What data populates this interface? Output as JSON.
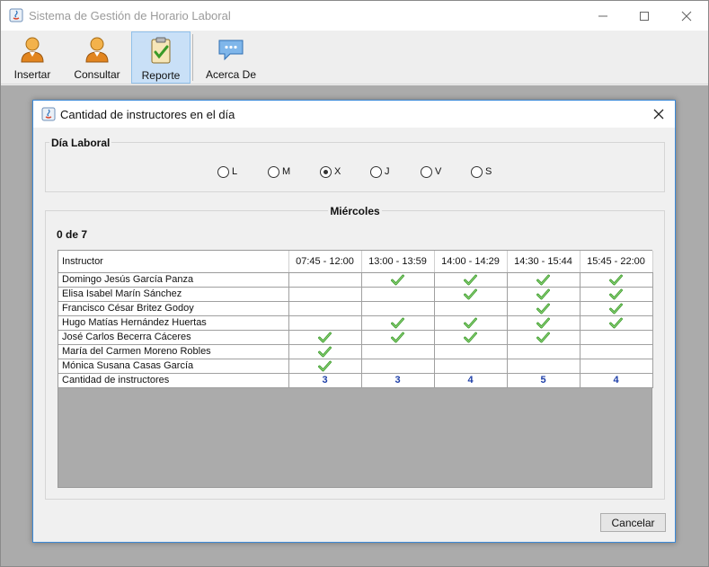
{
  "window": {
    "title": "Sistema de Gestión de Horario Laboral",
    "controls": [
      "minimize-icon",
      "maximize-icon",
      "close-icon"
    ]
  },
  "toolbar": {
    "buttons": [
      {
        "label": "Insertar",
        "icon": "user-icon"
      },
      {
        "label": "Consultar",
        "icon": "user-icon"
      },
      {
        "label": "Reporte",
        "icon": "clipboard-check-icon",
        "active": true
      },
      {
        "label": "Acerca De",
        "icon": "speech-bubble-icon"
      }
    ]
  },
  "dialog": {
    "title": "Cantidad de instructores en el día",
    "day_group": {
      "legend": "Día Laboral",
      "options": [
        "L",
        "M",
        "X",
        "J",
        "V",
        "S"
      ],
      "selected": "X"
    },
    "report_group": {
      "legend": "Miércoles",
      "count_label": "0 de 7"
    },
    "table": {
      "columns": [
        "Instructor",
        "07:45 - 12:00",
        "13:00 - 13:59",
        "14:00 - 14:29",
        "14:30 - 15:44",
        "15:45 - 22:00"
      ],
      "rows": [
        {
          "name": "Domingo Jesús García Panza",
          "checks": [
            false,
            true,
            true,
            true,
            true
          ]
        },
        {
          "name": "Elisa Isabel Marín Sánchez",
          "checks": [
            false,
            false,
            true,
            true,
            true
          ]
        },
        {
          "name": "Francisco César Britez Godoy",
          "checks": [
            false,
            false,
            false,
            true,
            true
          ]
        },
        {
          "name": "Hugo Matías Hernández Huertas",
          "checks": [
            false,
            true,
            true,
            true,
            true
          ]
        },
        {
          "name": "José Carlos Becerra Cáceres",
          "checks": [
            true,
            true,
            true,
            true,
            false
          ]
        },
        {
          "name": "María del Carmen Moreno Robles",
          "checks": [
            true,
            false,
            false,
            false,
            false
          ]
        },
        {
          "name": "Mónica Susana Casas García",
          "checks": [
            true,
            false,
            false,
            false,
            false
          ]
        }
      ],
      "total_label": "Cantidad de instructores",
      "totals": [
        "3",
        "3",
        "4",
        "5",
        "4"
      ]
    },
    "cancel_label": "Cancelar"
  },
  "colors": {
    "accent_border": "#3c8ad8",
    "active_tool_bg": "#c9e0f7",
    "total_text": "#1e3fa8",
    "check_green": "#3a9a28",
    "desktop_bg": "#ababab"
  }
}
